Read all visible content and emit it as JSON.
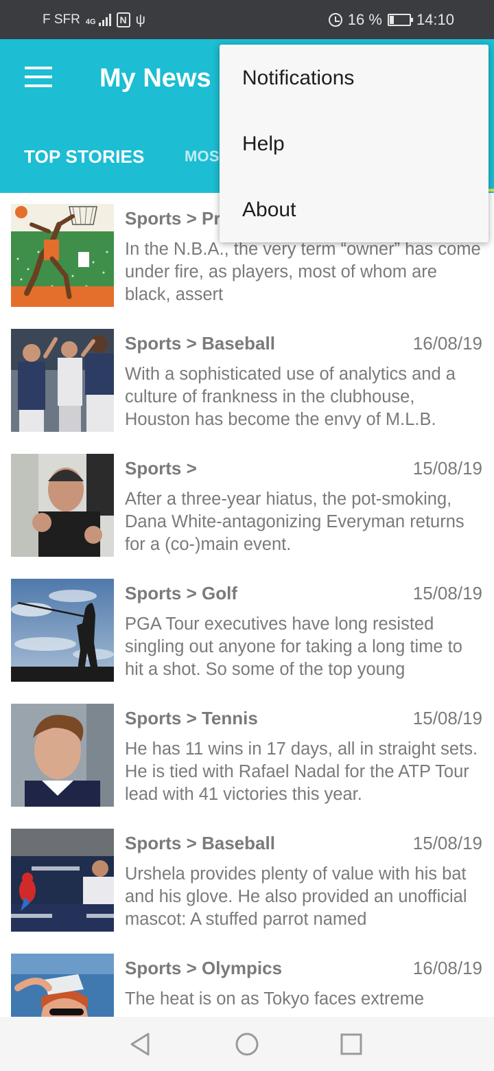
{
  "status_bar": {
    "carrier": "F SFR",
    "network": "4G",
    "battery_percent": "16 %",
    "time": "14:10",
    "icons": [
      "signal-icon",
      "nfc-icon",
      "usb-icon",
      "alarm-icon",
      "battery-icon"
    ]
  },
  "app_bar": {
    "title": "My News",
    "menu_icon": "hamburger-menu-icon",
    "background_color": "#1dbdd3"
  },
  "tabs": [
    {
      "label": "TOP STORIES",
      "selected": true
    },
    {
      "label": "MOS",
      "selected": false
    }
  ],
  "overflow_menu": {
    "items": [
      {
        "label": "Notifications"
      },
      {
        "label": "Help"
      },
      {
        "label": "About"
      }
    ]
  },
  "articles": [
    {
      "category": "Sports > Pr",
      "date": "",
      "abstract": "In the N.B.A., the very term “owner” has come under fire, as players, most of whom are black, assert",
      "thumbnail": "basketball-illustration"
    },
    {
      "category": "Sports > Baseball",
      "date": "16/08/19",
      "abstract": "With a sophisticated use of analytics and a culture of frankness in the clubhouse, Houston has become the envy of M.L.B.",
      "thumbnail": "astros-players-photo"
    },
    {
      "category": "Sports >",
      "date": "15/08/19",
      "abstract": "After a three-year hiatus, the pot-smoking, Dana White-antagonizing Everyman returns for a (co-)main event.",
      "thumbnail": "fighter-photo"
    },
    {
      "category": "Sports > Golf",
      "date": "15/08/19",
      "abstract": "PGA Tour executives have long resisted singling out anyone for taking a long time to hit a shot. So some of the top young",
      "thumbnail": "golfer-silhouette-photo"
    },
    {
      "category": "Sports > Tennis",
      "date": "15/08/19",
      "abstract": "He has 11 wins in 17 days, all in straight sets. He is tied with Rafael Nadal for the ATP Tour lead with 41 victories this year.",
      "thumbnail": "tennis-player-photo"
    },
    {
      "category": "Sports > Baseball",
      "date": "15/08/19",
      "abstract": "Urshela provides plenty of value with his bat and his glove. He also provided an unofficial mascot: A stuffed parrot named",
      "thumbnail": "yankees-parrot-photo"
    },
    {
      "category": "Sports > Olympics",
      "date": "16/08/19",
      "abstract": "The heat is on as Tokyo faces extreme",
      "thumbnail": "ice-pack-photo"
    }
  ],
  "nav_bar": {
    "buttons": [
      "back-icon",
      "home-icon",
      "recents-icon"
    ]
  }
}
